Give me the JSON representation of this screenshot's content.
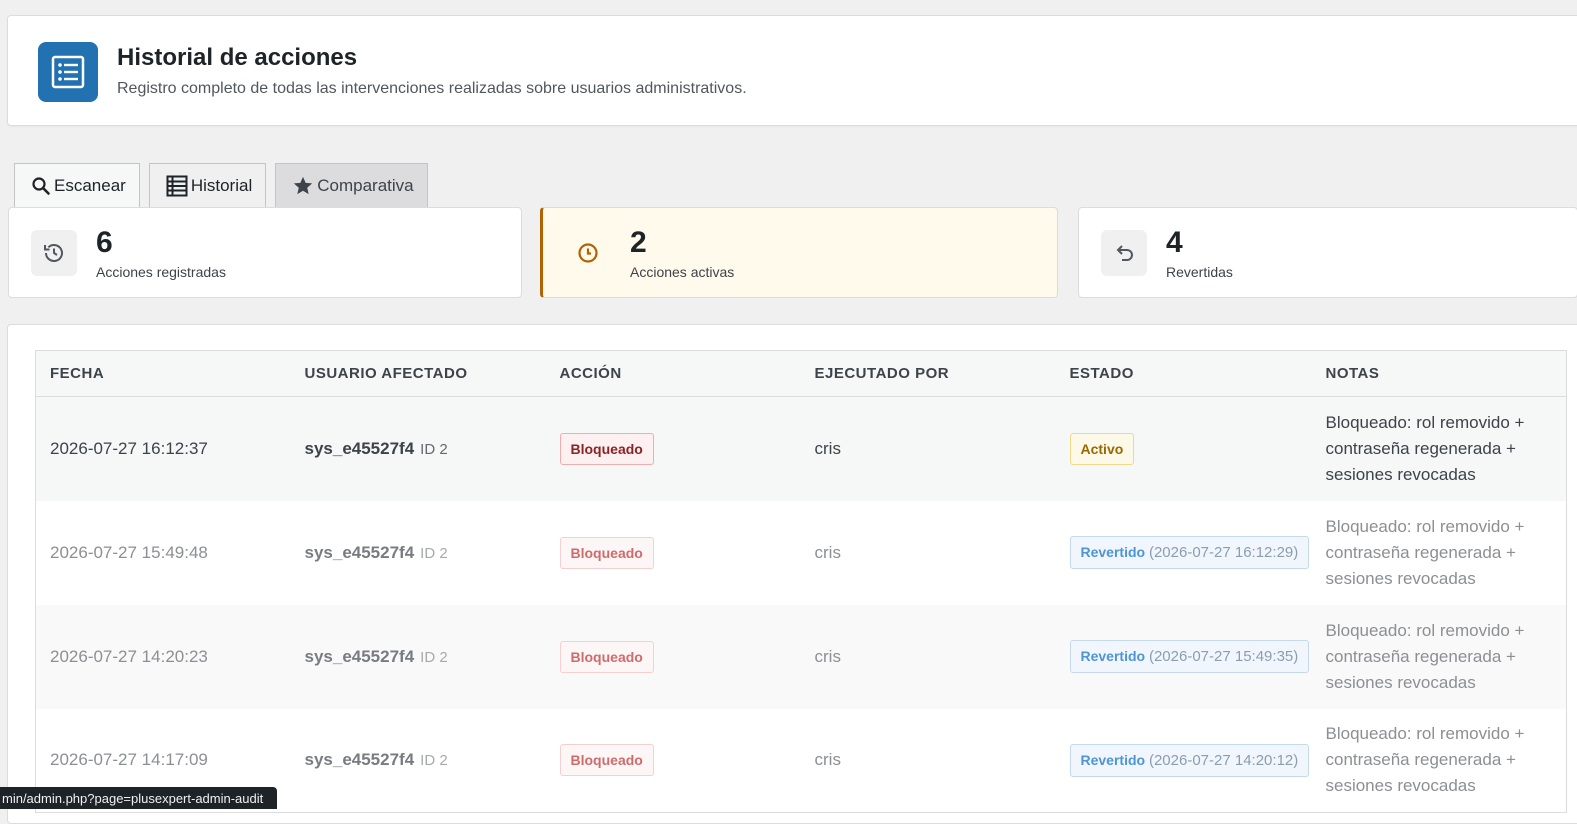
{
  "header": {
    "title": "Historial de acciones",
    "subtitle": "Registro completo de todas las intervenciones realizadas sobre usuarios administrativos.",
    "icon": "list-icon",
    "icon_color": "#2271b1"
  },
  "tabs": [
    {
      "label": "Escanear",
      "icon": "search-icon"
    },
    {
      "label": "Historial",
      "icon": "table-icon",
      "active": true
    },
    {
      "label": "Comparativa",
      "icon": "star-icon"
    }
  ],
  "stats": [
    {
      "value": "6",
      "label": "Acciones registradas",
      "icon": "history-icon"
    },
    {
      "value": "2",
      "label": "Acciones activas",
      "icon": "clock-icon",
      "accent": "#b26200"
    },
    {
      "value": "4",
      "label": "Revertidas",
      "icon": "undo-icon"
    }
  ],
  "table": {
    "columns": [
      "FECHA",
      "USUARIO AFECTADO",
      "ACCIÓN",
      "EJECUTADO POR",
      "ESTADO",
      "NOTAS"
    ],
    "rows": [
      {
        "fecha": "2026-07-27 16:12:37",
        "usuario": "sys_e45527f4",
        "usuario_id": "ID 2",
        "accion": "Bloqueado",
        "ejecutado_por": "cris",
        "estado": "Activo",
        "estado_fecha": "",
        "notas": "Bloqueado: rol removido + contraseña regenerada + sesiones revocadas"
      },
      {
        "fecha": "2026-07-27 15:49:48",
        "usuario": "sys_e45527f4",
        "usuario_id": "ID 2",
        "accion": "Bloqueado",
        "ejecutado_por": "cris",
        "estado": "Revertido",
        "estado_fecha": "(2026-07-27 16:12:29)",
        "notas": "Bloqueado: rol removido + contraseña regenerada + sesiones revocadas"
      },
      {
        "fecha": "2026-07-27 14:20:23",
        "usuario": "sys_e45527f4",
        "usuario_id": "ID 2",
        "accion": "Bloqueado",
        "ejecutado_por": "cris",
        "estado": "Revertido",
        "estado_fecha": "(2026-07-27 15:49:35)",
        "notas": "Bloqueado: rol removido + contraseña regenerada + sesiones revocadas"
      },
      {
        "fecha": "2026-07-27 14:17:09",
        "usuario": "sys_e45527f4",
        "usuario_id": "ID 2",
        "accion": "Bloqueado",
        "ejecutado_por": "cris",
        "estado": "Revertido",
        "estado_fecha": "(2026-07-27 14:20:12)",
        "notas": "Bloqueado: rol removido + contraseña regenerada + sesiones revocadas"
      }
    ]
  },
  "status_bar": {
    "url": "min/admin.php?page=plusexpert-admin-audit"
  }
}
